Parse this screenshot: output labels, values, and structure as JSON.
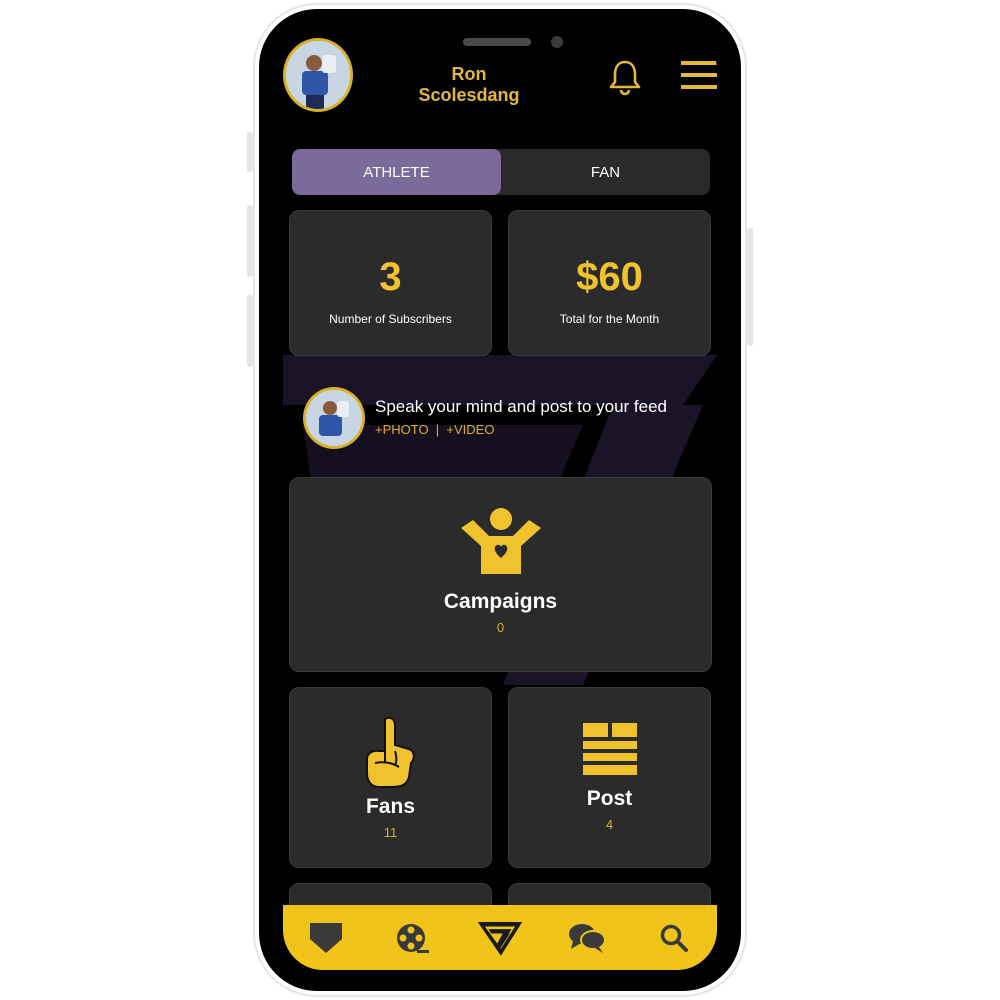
{
  "header": {
    "user_name": "Ron Scolesdang"
  },
  "segmented": {
    "athlete_label": "ATHLETE",
    "fan_label": "FAN",
    "active": "athlete"
  },
  "stats": {
    "subscribers_value": "3",
    "subscribers_label": "Number of Subscribers",
    "total_value": "$60",
    "total_label": "Total for the Month"
  },
  "composer": {
    "prompt": "Speak your mind and post to your feed",
    "actions": "+PHOTO  |  +VIDEO"
  },
  "tiles": {
    "campaigns": {
      "title": "Campaigns",
      "count": "0"
    },
    "fans": {
      "title": "Fans",
      "count": "11"
    },
    "post": {
      "title": "Post",
      "count": "4"
    }
  },
  "colors": {
    "accent": "#f0c22e",
    "nav_bar": "#f0c419",
    "active_segment": "#7a6b9a",
    "card": "#2b2b2b",
    "background": "#000000"
  },
  "icons": {
    "bell": "bell-icon",
    "menu": "hamburger-icon",
    "campaigns": "person-heart-icon",
    "fans": "foam-finger-icon",
    "post": "feed-layout-icon",
    "nav": [
      "home-plate-icon",
      "film-reel-icon",
      "app-logo-icon",
      "chat-bubbles-icon",
      "search-icon"
    ]
  }
}
